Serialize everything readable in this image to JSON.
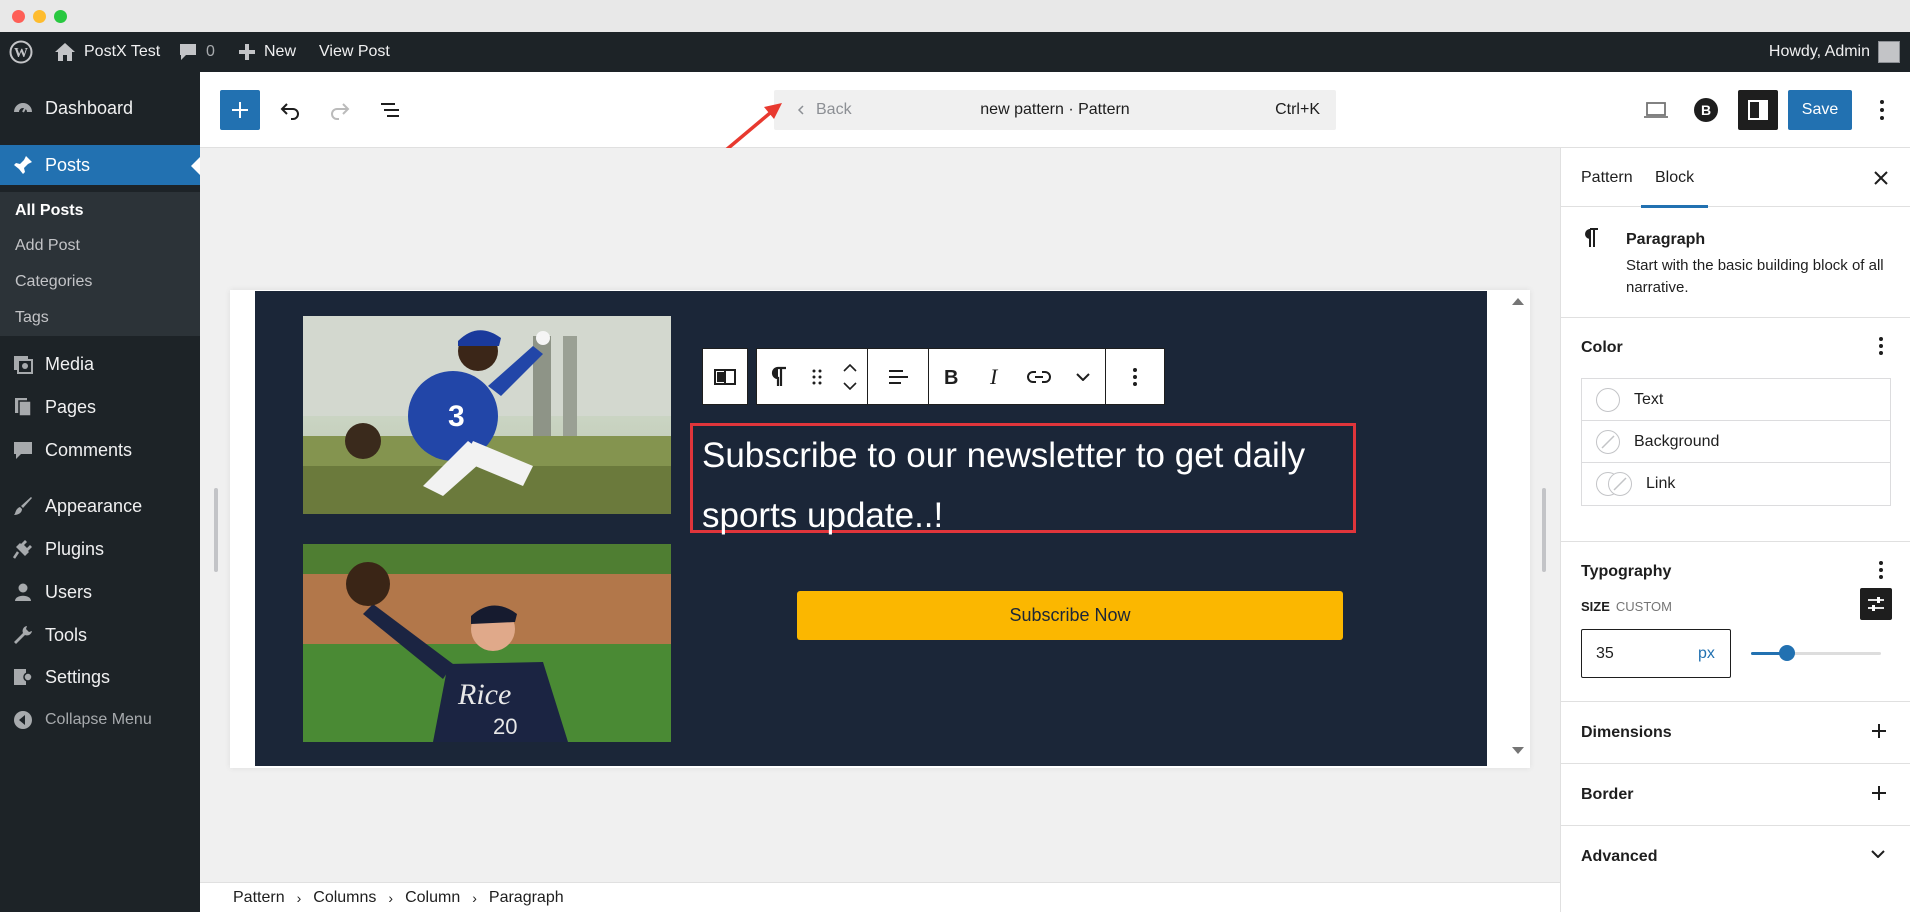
{
  "admin_bar": {
    "site_name": "PostX Test",
    "comments_count": "0",
    "new_label": "New",
    "view_post_label": "View Post",
    "greeting": "Howdy, Admin"
  },
  "admin_menu": {
    "items": [
      {
        "label": "Dashboard",
        "icon": "dashboard-icon"
      },
      {
        "label": "Posts",
        "icon": "pin-icon"
      },
      {
        "label": "Media",
        "icon": "media-icon"
      },
      {
        "label": "Pages",
        "icon": "pages-icon"
      },
      {
        "label": "Comments",
        "icon": "comment-icon"
      },
      {
        "label": "Appearance",
        "icon": "brush-icon"
      },
      {
        "label": "Plugins",
        "icon": "plug-icon"
      },
      {
        "label": "Users",
        "icon": "user-icon"
      },
      {
        "label": "Tools",
        "icon": "wrench-icon"
      },
      {
        "label": "Settings",
        "icon": "settings-icon"
      }
    ],
    "posts_submenu": [
      "All Posts",
      "Add Post",
      "Categories",
      "Tags"
    ],
    "collapse_label": "Collapse Menu"
  },
  "editor_header": {
    "back_label": "Back",
    "document_title": "new pattern · Pattern",
    "shortcut": "Ctrl+K",
    "save_label": "Save"
  },
  "canvas": {
    "paragraph_text": "Subscribe to our newsletter to get daily sports update..!",
    "button_text": "Subscribe Now",
    "colors": {
      "hero_bg": "#1b2638",
      "button_bg": "#fbb700",
      "highlight": "#e0353b",
      "accent": "#2271b1"
    }
  },
  "breadcrumb": [
    "Pattern",
    "Columns",
    "Column",
    "Paragraph"
  ],
  "sidebar": {
    "tabs": [
      "Pattern",
      "Block"
    ],
    "active_tab": "Block",
    "block": {
      "name": "Paragraph",
      "description": "Start with the basic building block of all narrative."
    },
    "color": {
      "title": "Color",
      "items": [
        "Text",
        "Background",
        "Link"
      ]
    },
    "typography": {
      "title": "Typography",
      "size_label": "SIZE",
      "size_mode": "CUSTOM",
      "size_value": "35",
      "size_unit": "px",
      "slider_fraction": 0.28
    },
    "panels": [
      "Dimensions",
      "Border",
      "Advanced"
    ]
  }
}
